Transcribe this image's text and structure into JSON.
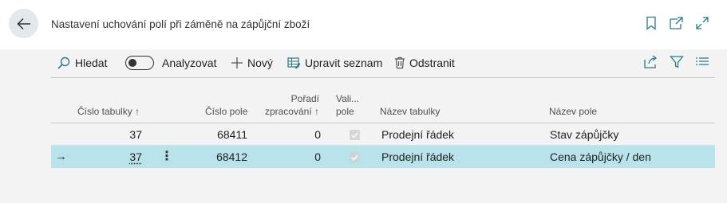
{
  "header": {
    "title": "Nastavení uchování polí při záměně na zápůjční zboží",
    "icons": [
      "back-arrow-icon",
      "bookmark-icon",
      "open-new-window-icon",
      "expand-icon"
    ]
  },
  "toolbar": {
    "search_label": "Hledat",
    "analyze_label": "Analyzovat",
    "new_label": "Nový",
    "edit_list_label": "Upravit seznam",
    "delete_label": "Odstranit"
  },
  "table": {
    "columns": {
      "table_no": "Číslo tabulky ↑",
      "field_no": "Číslo pole",
      "order_line1": "Pořadí",
      "order_line2": "zpracování ↑",
      "valid_line1": "Vali...",
      "valid_line2": "pole",
      "table_name": "Název tabulky",
      "field_name": "Název pole"
    },
    "rows": [
      {
        "table_no": "37",
        "field_no": "68411",
        "order": "0",
        "valid": true,
        "table_name": "Prodejní řádek",
        "field_name": "Stav zápůjčky"
      },
      {
        "table_no": "37",
        "field_no": "68412",
        "order": "0",
        "valid": true,
        "table_name": "Prodejní řádek",
        "field_name": "Cena zápůjčky / den",
        "selected": true,
        "row_arrow": "→",
        "row_menu": "⋮"
      }
    ]
  }
}
